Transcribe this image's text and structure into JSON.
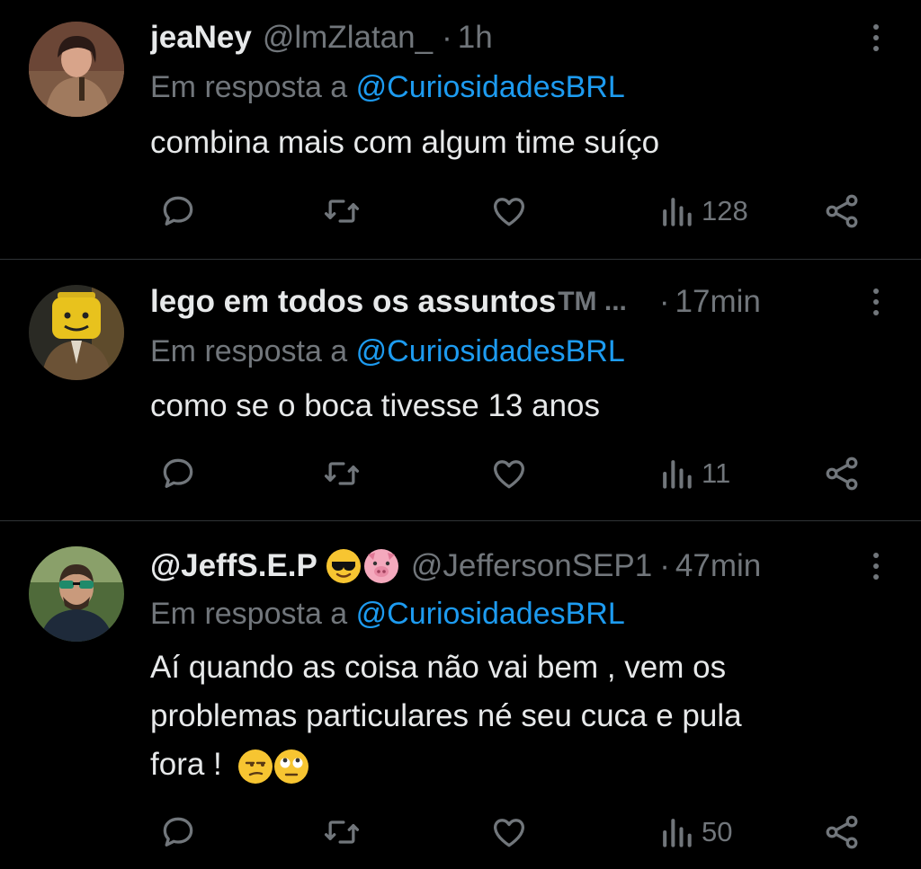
{
  "tweets": [
    {
      "name": "jeaNey",
      "handle": "@lmZlatan_",
      "time": "1h",
      "reply_prefix": "Em resposta a",
      "reply_to": "@CuriosidadesBRL",
      "text_lines": [
        "combina mais com algum time suíço"
      ],
      "views": "128"
    },
    {
      "name": "lego em todos os assuntos",
      "name_suffix": "TM ...",
      "time": "17min",
      "reply_prefix": "Em resposta a",
      "reply_to": "@CuriosidadesBRL",
      "text_lines": [
        "como se o boca tivesse 13 anos"
      ],
      "views": "11"
    },
    {
      "name": "@JeffS.E.P",
      "name_emojis": [
        "smiling-face-with-sunglasses",
        "pig-face"
      ],
      "handle": "@JeffersonSEP1",
      "time": "47min",
      "reply_prefix": "Em resposta a",
      "reply_to": "@CuriosidadesBRL",
      "text_lines": [
        "Aí quando as coisa não vai bem , vem os",
        "problemas particulares né seu cuca e pula",
        "fora !"
      ],
      "text_emojis": [
        "unamused-face",
        "face-with-rolling-eyes"
      ],
      "views": "50"
    }
  ],
  "separator": "·",
  "colors": {
    "background": "#000000",
    "text": "#e7e9ea",
    "muted": "#71767b",
    "mention": "#1d9bf0",
    "divider": "#2f3336"
  },
  "icons": [
    "reply-icon",
    "retweet-icon",
    "like-icon",
    "views-icon",
    "share-icon",
    "more-icon"
  ]
}
